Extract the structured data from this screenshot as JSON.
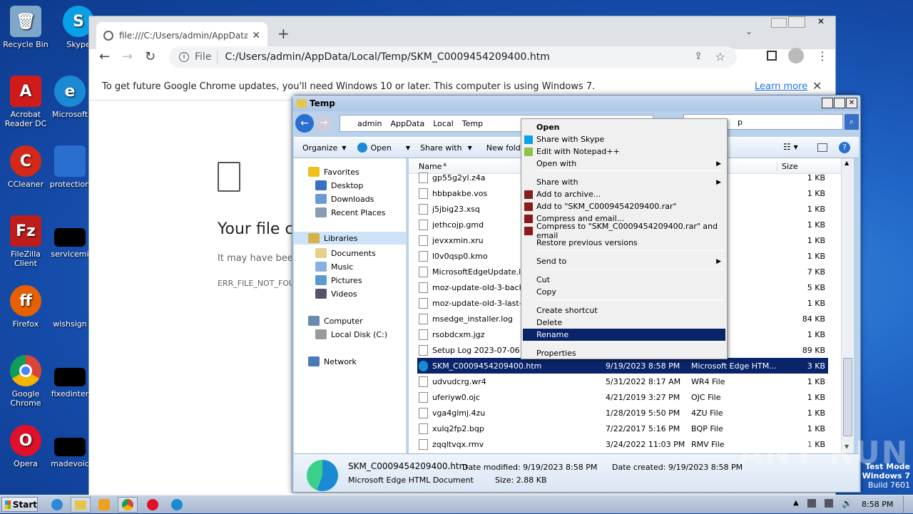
{
  "desktop": {
    "icons": [
      {
        "label": "Recycle Bin",
        "color": "#7fa7c9",
        "glyph": "🗑"
      },
      {
        "label": "Skype",
        "color": "#0aa0e8",
        "glyph": "S"
      },
      {
        "label": "Acrobat Reader DC",
        "color": "#d11a1a",
        "glyph": "A"
      },
      {
        "label": "Microsoft",
        "color": "#1a8ad4",
        "glyph": "e"
      },
      {
        "label": "CCleaner",
        "color": "#d4281a",
        "glyph": "C"
      },
      {
        "label": "protection",
        "color": "#2a6fd0",
        "glyph": ""
      },
      {
        "label": "FileZilla Client",
        "color": "#bf1c1c",
        "glyph": "Fz"
      },
      {
        "label": "servicemi",
        "color": "#000000",
        "glyph": ""
      },
      {
        "label": "Firefox",
        "color": "#e66000",
        "glyph": "🦊"
      },
      {
        "label": "wishsign",
        "color": "#2a6fd0",
        "glyph": ""
      },
      {
        "label": "Google Chrome",
        "color": "#2a9d3a",
        "glyph": "◉"
      },
      {
        "label": "fixedinter",
        "color": "#000000",
        "glyph": ""
      },
      {
        "label": "Opera",
        "color": "#e0102a",
        "glyph": "O"
      },
      {
        "label": "madevoic",
        "color": "#000000",
        "glyph": ""
      }
    ]
  },
  "chrome": {
    "tab_title": "file:///C:/Users/admin/AppData/Loca",
    "new_tab": "+",
    "scheme_label": "File",
    "url": "C:/Users/admin/AppData/Local/Temp/SKM_C0009454209400.htm",
    "infobar_text": "To get future Google Chrome updates, you'll need Windows 10 or later. This computer is using Windows 7.",
    "learn_more": "Learn more",
    "error_title": "Your file c",
    "error_desc": "It may have been",
    "error_code": "ERR_FILE_NOT_FOU"
  },
  "explorer": {
    "title": "Temp",
    "breadcrumb": [
      "admin",
      "AppData",
      "Local",
      "Temp"
    ],
    "search_text": "p",
    "commands": [
      "Organize",
      "Open",
      "Share with",
      "New folder"
    ],
    "nav": {
      "favorites": "Favorites",
      "desktop": "Desktop",
      "downloads": "Downloads",
      "recent": "Recent Places",
      "libraries": "Libraries",
      "documents": "Documents",
      "music": "Music",
      "pictures": "Pictures",
      "videos": "Videos",
      "computer": "Computer",
      "local_disk": "Local Disk (C:)",
      "network": "Network"
    },
    "columns": {
      "name": "Name",
      "size": "Size"
    },
    "files": [
      {
        "name": "gp55g2yl.z4a",
        "date": "",
        "type": "",
        "size": "1 KB"
      },
      {
        "name": "hbbpakbe.vos",
        "date": "",
        "type": "",
        "size": "1 KB"
      },
      {
        "name": "j5jbig23.xsq",
        "date": "",
        "type": "",
        "size": "1 KB"
      },
      {
        "name": "jethcojp.gmd",
        "date": "",
        "type": "",
        "size": "1 KB"
      },
      {
        "name": "jevxxmin.xru",
        "date": "",
        "type": "",
        "size": "1 KB"
      },
      {
        "name": "l0v0qsp0.kmo",
        "date": "",
        "type": "",
        "size": "1 KB"
      },
      {
        "name": "MicrosoftEdgeUpdate.log",
        "date": "",
        "type": "ment",
        "size": "7 KB"
      },
      {
        "name": "moz-update-old-3-backup",
        "date": "",
        "type": "ment",
        "size": "5 KB"
      },
      {
        "name": "moz-update-old-3-last-up",
        "date": "",
        "type": "ment",
        "size": "1 KB"
      },
      {
        "name": "msedge_installer.log",
        "date": "",
        "type": "ment",
        "size": "84 KB"
      },
      {
        "name": "rsobdcxm.jgz",
        "date": "",
        "type": "",
        "size": "1 KB"
      },
      {
        "name": "Setup Log 2023-07-06 #0",
        "date": "",
        "type": "ment",
        "size": "89 KB"
      },
      {
        "name": "SKM_C0009454209400.htm",
        "date": "9/19/2023 8:58 PM",
        "type": "Microsoft Edge HTM...",
        "size": "3 KB"
      },
      {
        "name": "udvudcrg.wr4",
        "date": "5/31/2022 8:17 AM",
        "type": "WR4 File",
        "size": "1 KB"
      },
      {
        "name": "uferiyw0.ojc",
        "date": "4/21/2019 3:27 PM",
        "type": "OJC File",
        "size": "1 KB"
      },
      {
        "name": "vga4glmj.4zu",
        "date": "1/28/2019 5:50 PM",
        "type": "4ZU File",
        "size": "1 KB"
      },
      {
        "name": "xulq2fp2.bqp",
        "date": "7/22/2017 5:16 PM",
        "type": "BQP File",
        "size": "1 KB"
      },
      {
        "name": "zqqltvqx.rmv",
        "date": "3/24/2022 11:03 PM",
        "type": "RMV File",
        "size": "1 KB"
      }
    ],
    "details": {
      "filename": "SKM_C0009454209400.htm",
      "filetype": "Microsoft Edge HTML Document",
      "modified": "Date modified: 9/19/2023 8:58 PM",
      "size": "Size: 2.88 KB",
      "created": "Date created: 9/19/2023 8:58 PM"
    }
  },
  "context_menu": [
    {
      "label": "Open",
      "bold": true
    },
    {
      "label": "Share with Skype"
    },
    {
      "label": "Edit with Notepad++"
    },
    {
      "label": "Open with",
      "sub": true
    },
    {
      "label": "Share with",
      "sub": true
    },
    {
      "label": "Add to archive..."
    },
    {
      "label": "Add to \"SKM_C0009454209400.rar\""
    },
    {
      "label": "Compress and email..."
    },
    {
      "label": "Compress to \"SKM_C0009454209400.rar\" and email"
    },
    {
      "label": "Restore previous versions"
    },
    {
      "label": "Send to",
      "sub": true
    },
    {
      "label": "Cut"
    },
    {
      "label": "Copy"
    },
    {
      "label": "Create shortcut"
    },
    {
      "label": "Delete"
    },
    {
      "label": "Rename",
      "highlight": true
    },
    {
      "label": "Properties"
    }
  ],
  "taskbar": {
    "start": "Start",
    "clock": "8:58 PM"
  },
  "watermark": {
    "line1": "Test Mode",
    "line2": "Windows 7",
    "line3": "Build 7601",
    "brand": "ANY RUN"
  }
}
